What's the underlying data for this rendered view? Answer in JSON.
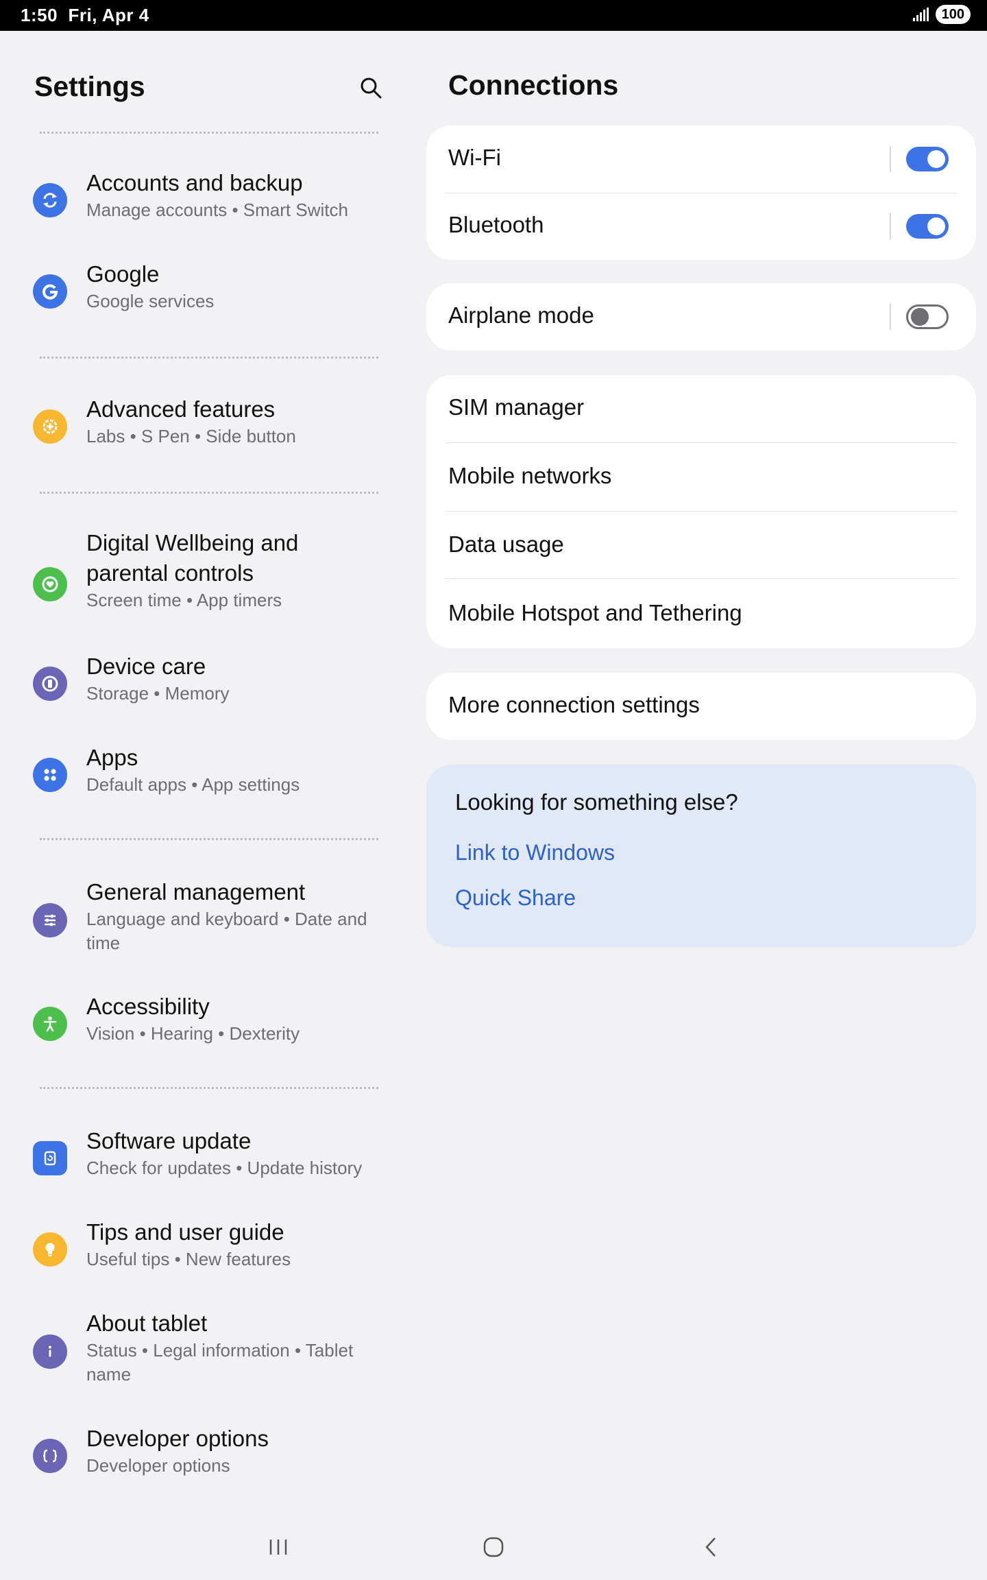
{
  "status_bar": {
    "time": "1:50",
    "date": "Fri, Apr 4",
    "battery": "100"
  },
  "left": {
    "title": "Settings",
    "items": [
      {
        "title": "Accounts and backup",
        "subtitle": "Manage accounts  •  Smart Switch",
        "icon": "sync-icon",
        "color": "#3e73e6"
      },
      {
        "title": "Google",
        "subtitle": "Google services",
        "icon": "google-icon",
        "color": "#3e73e6"
      },
      {
        "title": "Advanced features",
        "subtitle": "Labs  •  S Pen  •  Side button",
        "icon": "plus-gear-icon",
        "color": "#f7b731"
      },
      {
        "title": "Digital Wellbeing and parental controls",
        "subtitle": "Screen time  •  App timers",
        "icon": "heart-circle-icon",
        "color": "#4cbf4c"
      },
      {
        "title": "Device care",
        "subtitle": "Storage  •  Memory",
        "icon": "device-care-icon",
        "color": "#6a65b5"
      },
      {
        "title": "Apps",
        "subtitle": "Default apps  •  App settings",
        "icon": "apps-grid-icon",
        "color": "#3e73e6"
      },
      {
        "title": "General management",
        "subtitle": "Language and keyboard  •  Date and time",
        "icon": "sliders-icon",
        "color": "#6a65b5"
      },
      {
        "title": "Accessibility",
        "subtitle": "Vision  •  Hearing  •  Dexterity",
        "icon": "accessibility-icon",
        "color": "#4cbf4c"
      },
      {
        "title": "Software update",
        "subtitle": "Check for updates  •  Update history",
        "icon": "software-update-icon",
        "color": "#3e73e6"
      },
      {
        "title": "Tips and user guide",
        "subtitle": "Useful tips  •  New features",
        "icon": "lightbulb-icon",
        "color": "#f7b731"
      },
      {
        "title": "About tablet",
        "subtitle": "Status  •  Legal information  •  Tablet name",
        "icon": "info-icon",
        "color": "#6a65b5"
      },
      {
        "title": "Developer options",
        "subtitle": "Developer options",
        "icon": "braces-icon",
        "color": "#6a65b5"
      }
    ]
  },
  "right": {
    "title": "Connections",
    "wifi": {
      "label": "Wi-Fi",
      "on": true
    },
    "bluetooth": {
      "label": "Bluetooth",
      "on": true
    },
    "airplane": {
      "label": "Airplane mode",
      "on": false
    },
    "sim_manager": "SIM manager",
    "mobile_networks": "Mobile networks",
    "data_usage": "Data usage",
    "hotspot": "Mobile Hotspot and Tethering",
    "more": "More connection settings",
    "suggest": {
      "heading": "Looking for something else?",
      "links": [
        "Link to Windows",
        "Quick Share"
      ]
    }
  },
  "colors": {
    "accent": "#3e73e6",
    "link": "#2c62c9",
    "background": "#f2f2f4"
  }
}
